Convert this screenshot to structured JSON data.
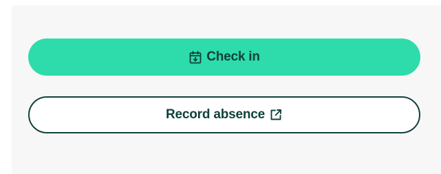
{
  "actions": {
    "check_in": {
      "label": "Check in",
      "icon": "calendar-check-in-icon"
    },
    "record_absence": {
      "label": "Record absence",
      "icon": "external-link-icon"
    }
  },
  "colors": {
    "primary": "#2edbaa",
    "text": "#10413b",
    "panel": "#f7f7f7"
  }
}
